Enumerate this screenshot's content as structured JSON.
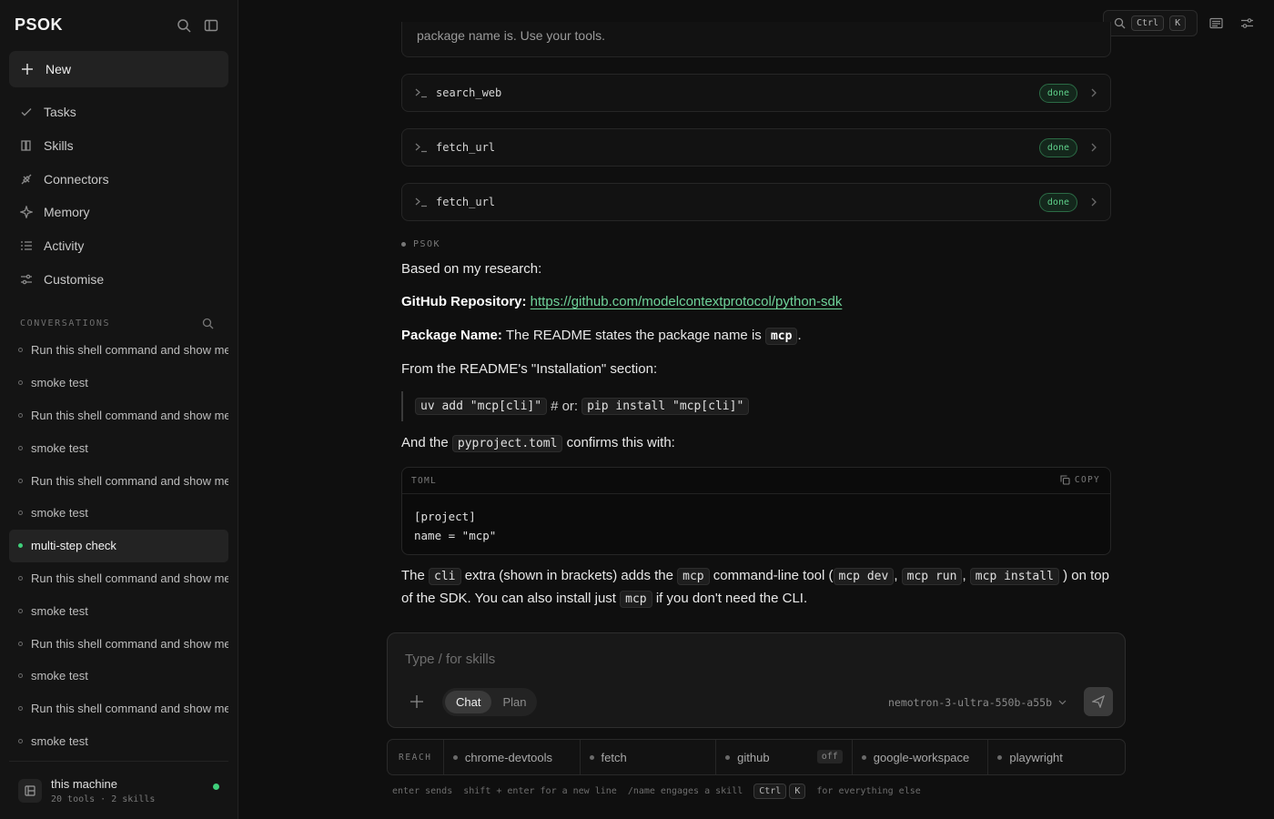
{
  "app": {
    "brand": "PSOK"
  },
  "sidebar": {
    "new_label": "New",
    "nav": [
      {
        "label": "Tasks",
        "icon": "check-icon"
      },
      {
        "label": "Skills",
        "icon": "book-icon"
      },
      {
        "label": "Connectors",
        "icon": "plug-icon"
      },
      {
        "label": "Memory",
        "icon": "sparkle-icon"
      },
      {
        "label": "Activity",
        "icon": "list-icon"
      },
      {
        "label": "Customise",
        "icon": "sliders-icon"
      }
    ],
    "conversations_header": "CONVERSATIONS",
    "conversations": [
      "Run this shell command and show me",
      "smoke test",
      "Run this shell command and show me",
      "smoke test",
      "Run this shell command and show me",
      "smoke test",
      "multi-step check",
      "Run this shell command and show me",
      "smoke test",
      "Run this shell command and show me",
      "smoke test",
      "Run this shell command and show me",
      "smoke test"
    ],
    "active_conversation_index": 6,
    "machine": {
      "name": "this machine",
      "detail": "20 tools · 2 skills",
      "status_color": "#3fcf7a"
    }
  },
  "topbar": {
    "search_key_1": "Ctrl",
    "search_key_2": "K"
  },
  "thread": {
    "previous_text": "package name is. Use your tools.",
    "tools": [
      {
        "name": "search_web",
        "status": "done"
      },
      {
        "name": "fetch_url",
        "status": "done"
      },
      {
        "name": "fetch_url",
        "status": "done"
      }
    ],
    "speaker": "PSOK",
    "intro": "Based on my research:",
    "repo_label": "GitHub Repository:",
    "repo_url": "https://github.com/modelcontextprotocol/python-sdk",
    "pkg_label": "Package Name:",
    "pkg_text": "The README states the package name is",
    "pkg_code": "mcp",
    "pkg_end": ".",
    "install_intro": "From the README's \"Installation\" section:",
    "quote_code_1": "uv add \"mcp[cli]\"",
    "quote_mid": "# or:",
    "quote_code_2": "pip install \"mcp[cli]\"",
    "confirm_pre": "And the",
    "confirm_code": "pyproject.toml",
    "confirm_post": "confirms this with:",
    "code_lang": "TOML",
    "code_copy": "COPY",
    "code_lines": [
      "[project]",
      "name = \"mcp\""
    ],
    "final": {
      "t1": "The",
      "c1": "cli",
      "t2": "extra (shown in brackets) adds the",
      "c2": "mcp",
      "t3": "command-line tool (",
      "c3": "mcp dev",
      "t4": ",",
      "c4": "mcp run",
      "t5": ",",
      "c5": "mcp install",
      "t6": ") on top of the SDK. You can also install just",
      "c6": "mcp",
      "t7": "if you don't need the CLI."
    }
  },
  "composer": {
    "placeholder": "Type / for skills",
    "mode_chat": "Chat",
    "mode_plan": "Plan",
    "active_mode": "Chat",
    "model": "nemotron-3-ultra-550b-a55b"
  },
  "reach": {
    "label": "REACH",
    "connectors": [
      {
        "name": "chrome-devtools",
        "badge": ""
      },
      {
        "name": "fetch",
        "badge": ""
      },
      {
        "name": "github",
        "badge": "off"
      },
      {
        "name": "google-workspace",
        "badge": ""
      },
      {
        "name": "playwright",
        "badge": ""
      }
    ]
  },
  "hints": {
    "h1": "enter sends",
    "h2": "shift + enter for a new line",
    "h3": "/name engages a skill",
    "k1": "Ctrl",
    "k2": "K",
    "h4": "for everything else"
  },
  "colors": {
    "accent_green": "#3fcf7a",
    "link_green": "#6fd49a",
    "background": "#0f0f0f"
  }
}
